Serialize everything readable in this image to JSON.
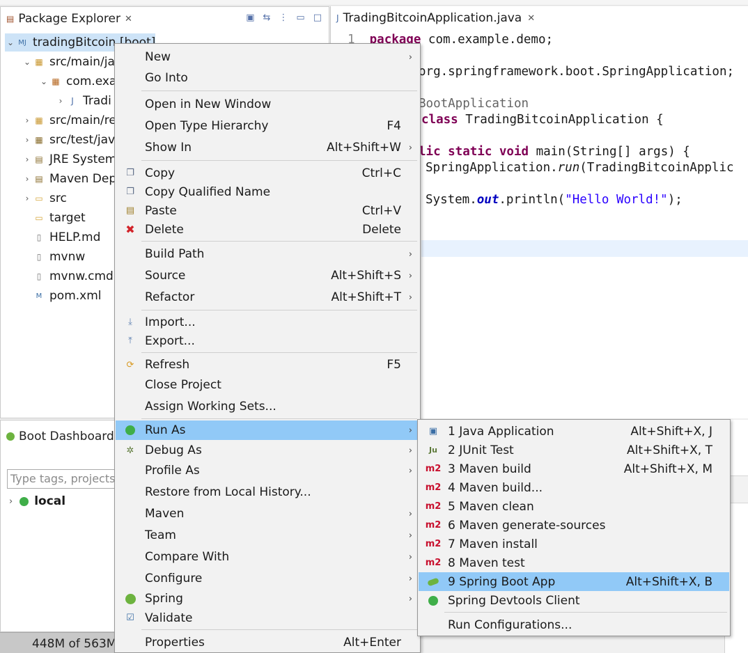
{
  "package_explorer": {
    "title": "Package Explorer",
    "tree": [
      {
        "label": "tradingBitcoin [boot]",
        "icon": "maven-project-icon"
      },
      {
        "label": "src/main/ja",
        "icon": "source-folder-icon"
      },
      {
        "label": "com.exa",
        "icon": "package-icon"
      },
      {
        "label": "Tradi",
        "icon": "java-file-icon"
      },
      {
        "label": "src/main/re",
        "icon": "source-folder-icon"
      },
      {
        "label": "src/test/jav",
        "icon": "source-folder-icon"
      },
      {
        "label": "JRE System",
        "icon": "library-icon"
      },
      {
        "label": "Maven Dep",
        "icon": "library-icon"
      },
      {
        "label": "src",
        "icon": "folder-icon"
      },
      {
        "label": "target",
        "icon": "folder-icon"
      },
      {
        "label": "HELP.md",
        "icon": "file-icon"
      },
      {
        "label": "mvnw",
        "icon": "file-icon"
      },
      {
        "label": "mvnw.cmd",
        "icon": "file-icon"
      },
      {
        "label": "pom.xml",
        "icon": "maven-file-icon"
      }
    ]
  },
  "editor": {
    "tab": "TradingBitcoinApplication.java",
    "line_number": "1",
    "line1_kw": "package",
    "line1_rest": " com.example.demo;",
    "line2": "org.springframework.boot.SpringApplication;",
    "line3": "BootApplication",
    "line4_kw": "class",
    "line4_rest": " TradingBitcoinApplication {",
    "line5_kw": "lic static void",
    "line5_rest": " main(String[] args) {",
    "line6_a": "SpringApplication.",
    "line6_run": "run",
    "line6_b": "(TradingBitcoinApplic",
    "line7_a": "System.",
    "line7_out": "out",
    "line7_b": ".println(",
    "line7_str": "\"Hello World!\"",
    "line7_c": ");"
  },
  "boot_dashboard": {
    "title": "Boot Dashboard",
    "filter_placeholder": "Type tags, projects",
    "local_label": "local"
  },
  "status_bar": {
    "memory": "448M of 563M"
  },
  "context_menu": {
    "items": {
      "new": "New",
      "go_into": "Go Into",
      "open_new_window": "Open in New Window",
      "open_type_hierarchy": "Open Type Hierarchy",
      "open_type_hierarchy_sc": "F4",
      "show_in": "Show In",
      "show_in_sc": "Alt+Shift+W",
      "copy": "Copy",
      "copy_sc": "Ctrl+C",
      "copy_qualified": "Copy Qualified Name",
      "paste": "Paste",
      "paste_sc": "Ctrl+V",
      "delete": "Delete",
      "delete_sc": "Delete",
      "build_path": "Build Path",
      "source": "Source",
      "source_sc": "Alt+Shift+S",
      "refactor": "Refactor",
      "refactor_sc": "Alt+Shift+T",
      "import": "Import...",
      "export": "Export...",
      "refresh": "Refresh",
      "refresh_sc": "F5",
      "close_project": "Close Project",
      "assign_working_sets": "Assign Working Sets...",
      "run_as": "Run As",
      "debug_as": "Debug As",
      "profile_as": "Profile As",
      "restore_history": "Restore from Local History...",
      "maven": "Maven",
      "team": "Team",
      "compare_with": "Compare With",
      "configure": "Configure",
      "spring": "Spring",
      "validate": "Validate",
      "properties": "Properties",
      "properties_sc": "Alt+Enter"
    }
  },
  "run_as_submenu": {
    "items": {
      "java_app": "1 Java Application",
      "java_app_sc": "Alt+Shift+X, J",
      "junit": "2 JUnit Test",
      "junit_sc": "Alt+Shift+X, T",
      "maven_build": "3 Maven build",
      "maven_build_sc": "Alt+Shift+X, M",
      "maven_build2": "4 Maven build...",
      "maven_clean": "5 Maven clean",
      "maven_gen": "6 Maven generate-sources",
      "maven_install": "7 Maven install",
      "maven_test": "8 Maven test",
      "spring_boot": "9 Spring Boot App",
      "spring_boot_sc": "Alt+Shift+X, B",
      "devtools": "Spring Devtools Client",
      "run_configs": "Run Configurations..."
    },
    "m2": "m2",
    "ju": "Ju"
  },
  "colors": {
    "hover": "#91c9f7",
    "selection": "#cde3f7",
    "keyword": "#7f0055",
    "string": "#2a00ff",
    "spring_green": "#6db33f"
  }
}
